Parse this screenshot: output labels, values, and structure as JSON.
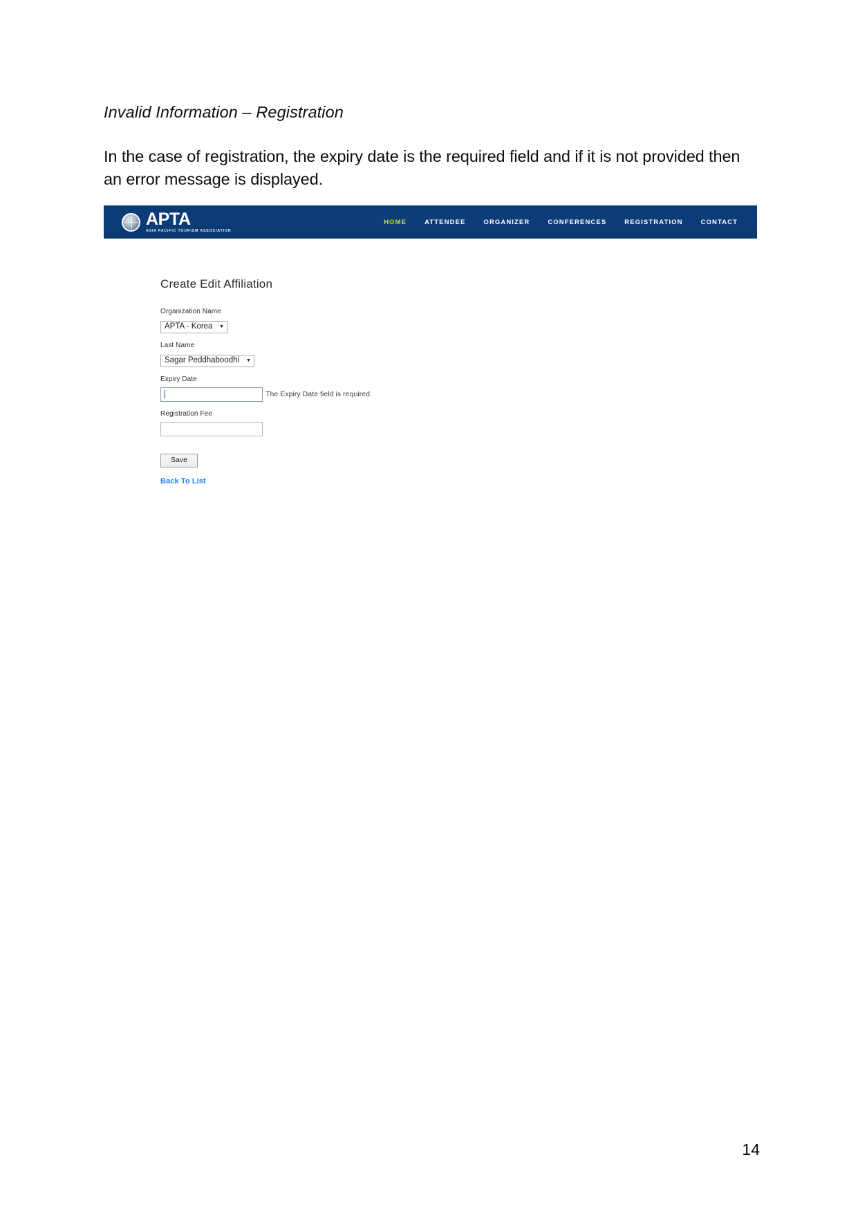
{
  "document": {
    "heading": "Invalid Information – Registration",
    "paragraph": "In the case of registration, the expiry date is the required field and if it is not provided then an error message is displayed.",
    "page_number": "14"
  },
  "screenshot": {
    "navbar": {
      "brand": {
        "title": "APTA",
        "subtitle": "ASIA PACIFIC TOURISM ASSOCIATION",
        "logo_icon": "globe-icon"
      },
      "active_color": "#c9dc4b",
      "background_color": "#0b3d77",
      "items": [
        {
          "label": "HOME",
          "active": true
        },
        {
          "label": "ATTENDEE",
          "active": false
        },
        {
          "label": "ORGANIZER",
          "active": false
        },
        {
          "label": "CONFERENCES",
          "active": false
        },
        {
          "label": "REGISTRATION",
          "active": false
        },
        {
          "label": "CONTACT",
          "active": false
        }
      ]
    },
    "form": {
      "title": "Create Edit Affiliation",
      "fields": [
        {
          "label": "Organization Name",
          "type": "select",
          "value": "APTA - Korea",
          "caret_icon": "chevron-down-icon"
        },
        {
          "label": "Last Name",
          "type": "select",
          "value": "Sagar Peddhaboodhi",
          "caret_icon": "chevron-down-icon"
        },
        {
          "label": "Expiry Date",
          "type": "text",
          "value": "",
          "placeholder": "",
          "error": "The Expiry Date field is required.",
          "focused": true
        },
        {
          "label": "Registration Fee",
          "type": "text",
          "value": "",
          "placeholder": "",
          "error": "",
          "focused": false
        }
      ],
      "save_label": "Save",
      "back_link_label": "Back To List",
      "link_color": "#1a7ef0"
    }
  }
}
